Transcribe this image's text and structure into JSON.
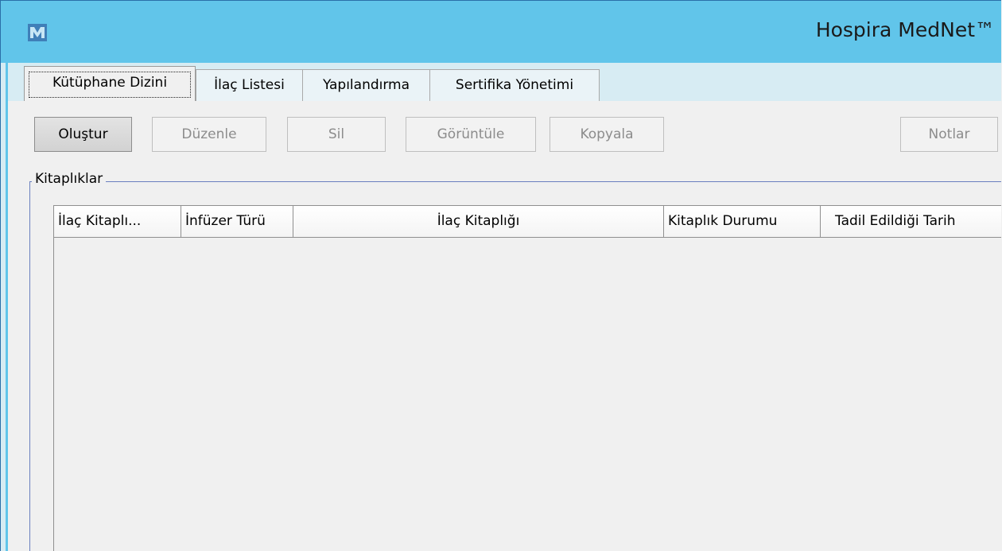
{
  "window": {
    "title": "Hospira MedNet™",
    "icon": "mednet-app-icon",
    "accent_color": "#61c5ea"
  },
  "tabs": [
    {
      "label": "Kütüphane Dizini",
      "active": true
    },
    {
      "label": "İlaç Listesi",
      "active": false
    },
    {
      "label": "Yapılandırma",
      "active": false
    },
    {
      "label": "Sertifika Yönetimi",
      "active": false
    }
  ],
  "toolbar": {
    "create_label": "Oluştur",
    "edit_label": "Düzenle",
    "delete_label": "Sil",
    "view_label": "Görüntüle",
    "copy_label": "Kopyala",
    "notes_label": "Notlar"
  },
  "libraries_group": {
    "title": "Kitaplıklar",
    "columns": [
      "İlaç Kitaplı...",
      "İnfüzer Türü",
      "İlaç Kitaplığı",
      "Kitaplık Durumu",
      "Tadil Edildiği Tarih"
    ],
    "rows": []
  }
}
